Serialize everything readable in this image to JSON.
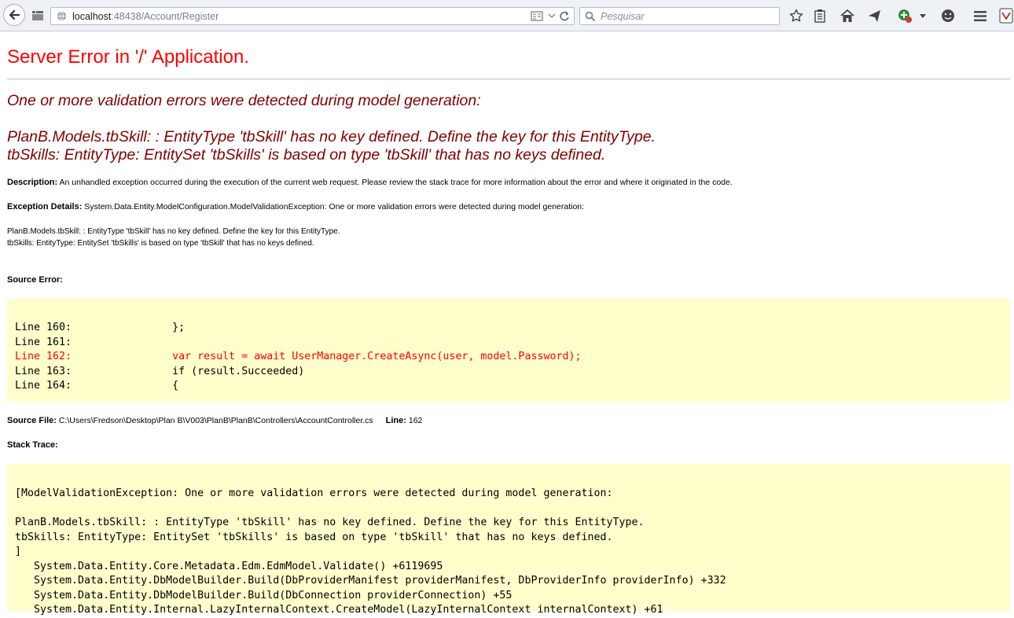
{
  "browser": {
    "url_host": "localhost",
    "url_rest": ":48438/Account/Register",
    "search_placeholder": "Pesquisar"
  },
  "page": {
    "title": "Server Error in '/' Application.",
    "heading": "One or more validation errors were detected during model generation:",
    "error_line1": "PlanB.Models.tbSkill: : EntityType 'tbSkill' has no key defined. Define the key for this EntityType.",
    "error_line2": "tbSkills: EntityType: EntitySet 'tbSkills' is based on type 'tbSkill' that has no keys defined.",
    "description_label": "Description:",
    "description_text": " An unhandled exception occurred during the execution of the current web request. Please review the stack trace for more information about the error and where it originated in the code.",
    "exception_label": "Exception Details:",
    "exception_text": " System.Data.Entity.ModelConfiguration.ModelValidationException: One or more validation errors were detected during model generation:",
    "detail_line1": "PlanB.Models.tbSkill: : EntityType 'tbSkill' has no key defined. Define the key for this EntityType.",
    "detail_line2": "tbSkills: EntityType: EntitySet 'tbSkills' is based on type 'tbSkill' that has no keys defined.",
    "source_error_label": "Source Error:",
    "source_lines": [
      "Line 160:                };",
      "Line 161:",
      "Line 162:                var result = await UserManager.CreateAsync(user, model.Password);",
      "Line 163:                if (result.Succeeded)",
      "Line 164:                {"
    ],
    "source_file_label": "Source File:",
    "source_file_path": " C:\\Users\\Fredson\\Desktop\\Plan B\\V003\\PlanB\\PlanB\\Controllers\\AccountController.cs",
    "line_label": "Line:",
    "line_number": " 162",
    "stack_trace_label": "Stack Trace:",
    "stack_lines": [
      "[ModelValidationException: One or more validation errors were detected during model generation:",
      "",
      "PlanB.Models.tbSkill: : EntityType 'tbSkill' has no key defined. Define the key for this EntityType.",
      "tbSkills: EntityType: EntitySet 'tbSkills' is based on type 'tbSkill' that has no keys defined.",
      "]",
      "   System.Data.Entity.Core.Metadata.Edm.EdmModel.Validate() +6119695",
      "   System.Data.Entity.DbModelBuilder.Build(DbProviderManifest providerManifest, DbProviderInfo providerInfo) +332",
      "   System.Data.Entity.DbModelBuilder.Build(DbConnection providerConnection) +55",
      "   System.Data.Entity.Internal.LazyInternalContext.CreateModel(LazyInternalContext internalContext) +61"
    ]
  }
}
